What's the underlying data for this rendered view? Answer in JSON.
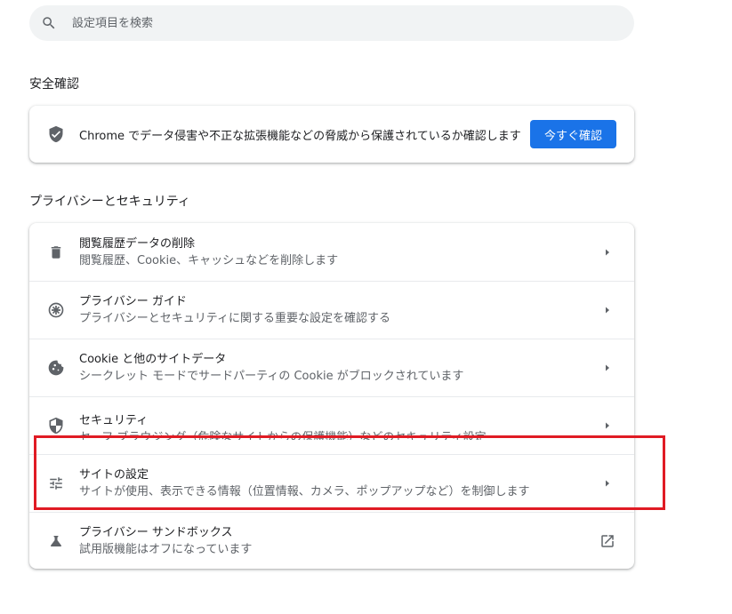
{
  "search": {
    "placeholder": "設定項目を検索",
    "icon": "search-icon"
  },
  "safety_check": {
    "title": "安全確認",
    "description": "Chrome でデータ侵害や不正な拡張機能などの脅威から保護されているか確認します",
    "button_label": "今すぐ確認",
    "icon": "shield-check-icon",
    "accent_color": "#1a73e8"
  },
  "privacy_security": {
    "title": "プライバシーとセキュリティ",
    "items": [
      {
        "title": "閲覧履歴データの削除",
        "subtitle": "閲覧履歴、Cookie、キャッシュなどを削除します",
        "icon": "trash-icon",
        "action_icon": "chevron-right-icon"
      },
      {
        "title": "プライバシー ガイド",
        "subtitle": "プライバシーとセキュリティに関する重要な設定を確認する",
        "icon": "compass-icon",
        "action_icon": "chevron-right-icon"
      },
      {
        "title": "Cookie と他のサイトデータ",
        "subtitle": "シークレット モードでサードパーティの Cookie がブロックされています",
        "icon": "cookie-icon",
        "action_icon": "chevron-right-icon"
      },
      {
        "title": "セキュリティ",
        "subtitle": "セーフ ブラウジング（危険なサイトからの保護機能）などのセキュリティ設定",
        "icon": "security-shield-icon",
        "action_icon": "chevron-right-icon"
      },
      {
        "title": "サイトの設定",
        "subtitle": "サイトが使用、表示できる情報（位置情報、カメラ、ポップアップなど）を制御します",
        "icon": "tune-icon",
        "action_icon": "chevron-right-icon"
      },
      {
        "title": "プライバシー サンドボックス",
        "subtitle": "試用版機能はオフになっています",
        "icon": "flask-icon",
        "action_icon": "external-link-icon"
      }
    ]
  },
  "annotation": {
    "highlight_color": "#e01b24"
  }
}
